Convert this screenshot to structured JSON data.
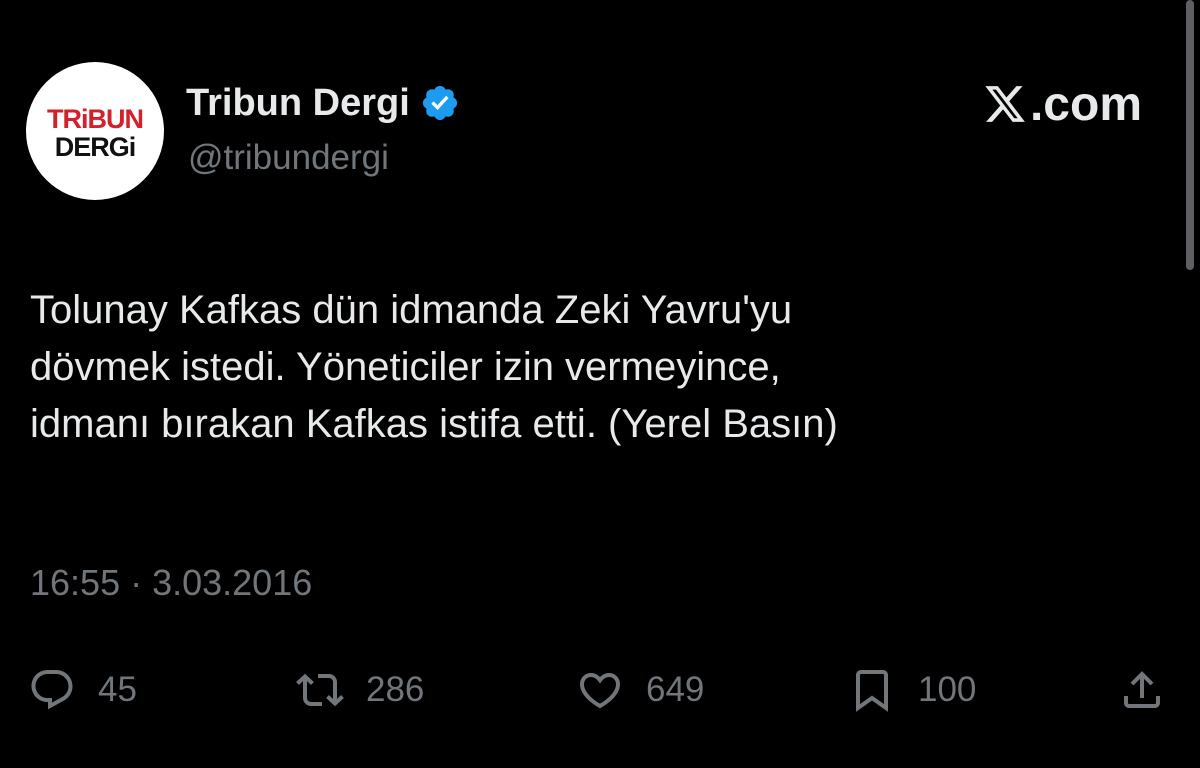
{
  "account": {
    "display_name": "Tribun Dergi",
    "handle": "@tribundergi",
    "verified": true,
    "avatar_logo_line1": "TRiBUN",
    "avatar_logo_line2": "DERGi"
  },
  "brand": {
    "text": ".com",
    "icon": "x-logo-icon"
  },
  "tweet": {
    "text": "Tolunay Kafkas dün idmanda Zeki Yavru'yu\ndövmek istedi. Yöneticiler izin vermeyince,\nidmanı bırakan Kafkas istifa etti. (Yerel Basın)",
    "time": "16:55",
    "separator": " · ",
    "date": "3.03.2016"
  },
  "actions": {
    "reply": {
      "icon": "reply-icon",
      "count": "45"
    },
    "retweet": {
      "icon": "retweet-icon",
      "count": "286"
    },
    "like": {
      "icon": "heart-icon",
      "count": "649"
    },
    "bookmark": {
      "icon": "bookmark-icon",
      "count": "100"
    },
    "share": {
      "icon": "share-icon"
    }
  },
  "colors": {
    "background": "#000000",
    "primary_text": "#e7e9ea",
    "secondary_text": "#71767b",
    "verified_badge": "#1d9bf0",
    "logo_red": "#d4202a"
  }
}
